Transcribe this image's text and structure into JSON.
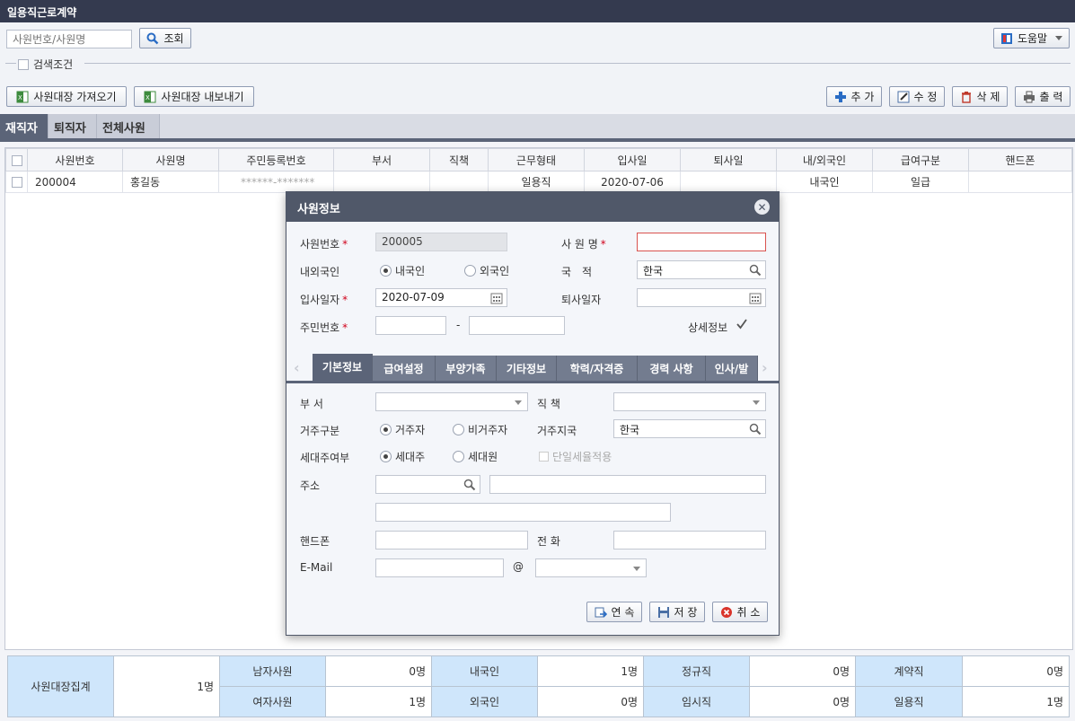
{
  "window": {
    "title": "일용직근로계약"
  },
  "search": {
    "placeholder": "사원번호/사원명",
    "search_button": "조회",
    "help_button": "도움말",
    "condition_label": "검색조건"
  },
  "actions": {
    "import": "사원대장 가져오기",
    "export": "사원대장 내보내기",
    "add": "추 가",
    "edit": "수 정",
    "delete": "삭 제",
    "print": "출 력"
  },
  "tabs": [
    {
      "label": "재직자",
      "active": true
    },
    {
      "label": "퇴직자",
      "active": false
    },
    {
      "label": "전체사원",
      "active": false
    }
  ],
  "grid": {
    "columns": [
      "사원번호",
      "사원명",
      "주민등록번호",
      "부서",
      "직책",
      "근무형태",
      "입사일",
      "퇴사일",
      "내/외국인",
      "급여구분",
      "핸드폰"
    ],
    "rows": [
      {
        "emp_no": "200004",
        "name": "홍길동",
        "rrn": "******-*******",
        "dept": "",
        "position": "",
        "work_type": "일용직",
        "join_date": "2020-07-06",
        "leave_date": "",
        "nationality": "내국인",
        "pay_type": "일급",
        "phone": ""
      }
    ]
  },
  "summary": {
    "title": "사원대장집계",
    "total": "1명",
    "male_label": "남자사원",
    "male": "0명",
    "female_label": "여자사원",
    "female": "1명",
    "domestic_label": "내국인",
    "domestic": "1명",
    "foreign_label": "외국인",
    "foreign": "0명",
    "regular_label": "정규직",
    "regular": "0명",
    "temp_label": "임시직",
    "temp": "0명",
    "contract_label": "계약직",
    "contract": "0명",
    "daily_label": "일용직",
    "daily": "1명"
  },
  "modal": {
    "title": "사원정보",
    "emp_no_label": "사원번호",
    "emp_no_value": "200005",
    "name_label": "사 원 명",
    "name_value": "",
    "nationality_label": "내외국인",
    "domestic": "내국인",
    "foreign": "외국인",
    "country_label": "국　적",
    "country_value": "한국",
    "join_label": "입사일자",
    "join_value": "2020-07-09",
    "leave_label": "퇴사일자",
    "leave_value": "",
    "rrn_label": "주민번호",
    "rrn_dash": "-",
    "detail_label": "상세정보",
    "tabs": [
      "기본정보",
      "급여설정",
      "부양가족",
      "기타정보",
      "학력/자격증",
      "경력 사항",
      "인사/발"
    ],
    "dept_label": "부 서",
    "dept_value": "",
    "position_label": "직 책",
    "position_value": "",
    "residence_label": "거주구분",
    "resident": "거주자",
    "nonresident": "비거주자",
    "residence_country_label": "거주지국",
    "residence_country_value": "한국",
    "householder_label": "세대주여부",
    "householder": "세대주",
    "member": "세대원",
    "single_tax_label": "단일세율적용",
    "address_label": "주소",
    "mobile_label": "핸드폰",
    "phone_label": "전 화",
    "email_label": "E-Mail",
    "at": "@",
    "continue_button": "연 속",
    "save_button": "저 장",
    "cancel_button": "취 소"
  }
}
